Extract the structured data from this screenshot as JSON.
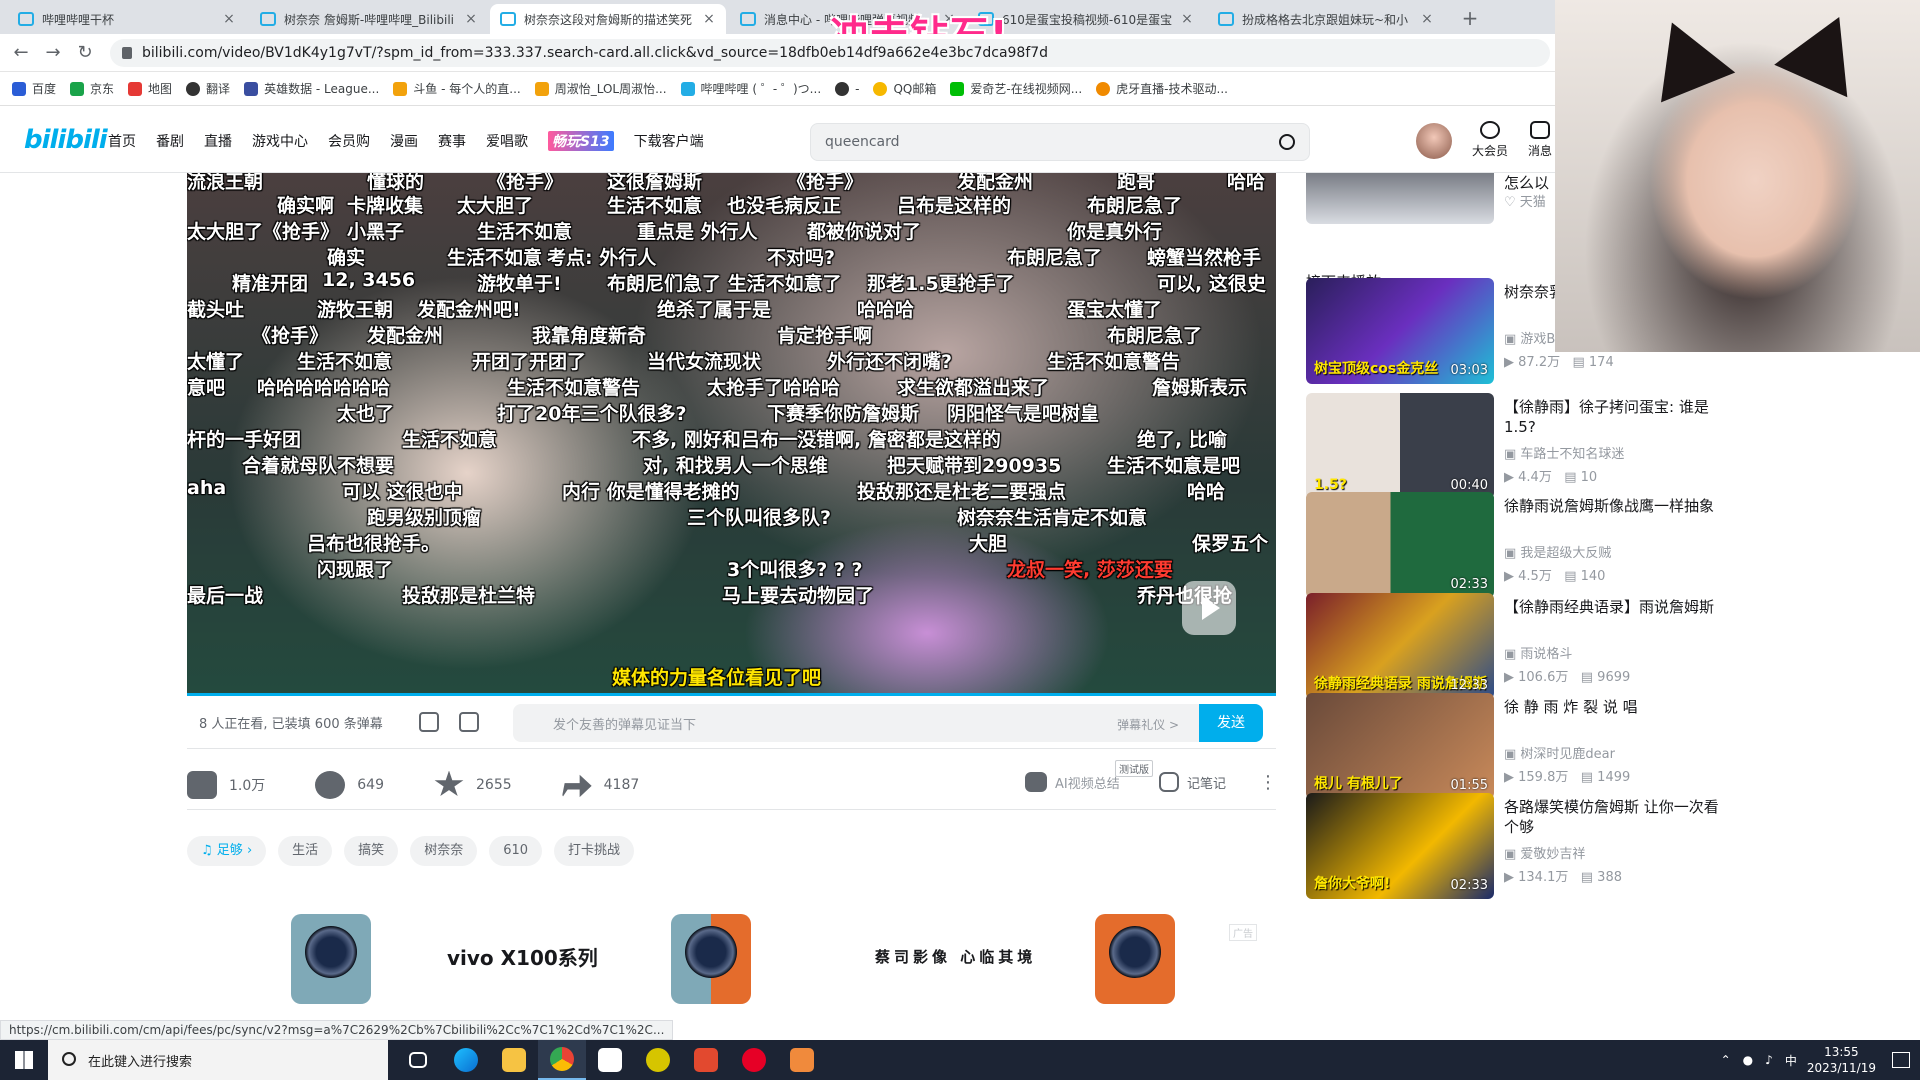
{
  "browser": {
    "tabs": [
      {
        "title": "哔哩哔哩干杯"
      },
      {
        "title": "树奈奈 詹姆斯-哔哩哔哩_Bilibili"
      },
      {
        "title": "树奈奈这段对詹姆斯的描述笑死"
      },
      {
        "title": "消息中心 - 哔哩哔哩弹幕视频"
      },
      {
        "title": "610是蛋宝投稿视频-610是蛋宝"
      },
      {
        "title": "扮成格格去北京跟姐妹玩~和小"
      }
    ],
    "url": "bilibili.com/video/BV1dK4y1g7vT/?spm_id_from=333.337.search-card.all.click&vd_source=18dfb0eb14df9a662e4e3bc7dca98f7d",
    "overlay_text": "冲击钻石!",
    "bookmarks": [
      "百度",
      "京东",
      "地图",
      "翻译",
      "英雄数据 - League...",
      "斗鱼 - 每个人的直...",
      "周淑怡_LOL周淑怡...",
      "哔哩哔哩 ( ゜- ゜)つ...",
      "-",
      "QQ邮箱",
      "爱奇艺-在线视频网...",
      "虎牙直播-技术驱动..."
    ],
    "status_url": "https://cm.bilibili.com/cm/api/fees/pc/sync/v2?msg=a%7C2629%2Cb%7Cbilibili%2Cc%7C1%2Cd%7C1%2C..."
  },
  "bili_header": {
    "logo": "bilibili",
    "nav": [
      "首页",
      "番剧",
      "直播",
      "游戏中心",
      "会员购",
      "漫画",
      "赛事",
      "爱唱歌",
      "畅玩S13",
      "下载客户端"
    ],
    "search_value": "queencard",
    "btn_vip": "大会员",
    "btn_msg": "消息"
  },
  "danmaku": [
    {
      "t": "流浪王朝"
    },
    {
      "t": "懂球的"
    },
    {
      "t": "《抢手》"
    },
    {
      "t": "这很詹姆斯"
    },
    {
      "t": "《抢手》"
    },
    {
      "t": "发配金州"
    },
    {
      "t": "跑哥"
    },
    {
      "t": "哈哈"
    },
    {
      "t": "确实啊"
    },
    {
      "t": "卡牌收集"
    },
    {
      "t": "太大胆了"
    },
    {
      "t": "生活不如意"
    },
    {
      "t": "也没毛病反正"
    },
    {
      "t": "吕布是这样的"
    },
    {
      "t": "布朗尼急了"
    },
    {
      "t": "太大胆了《抢手》"
    },
    {
      "t": "小黑子"
    },
    {
      "t": "生活不如意"
    },
    {
      "t": "重点是 外行人"
    },
    {
      "t": "都被你说对了"
    },
    {
      "t": "你是真外行"
    },
    {
      "t": "确实"
    },
    {
      "t": "生活不如意"
    },
    {
      "t": "考点: 外行人"
    },
    {
      "t": "不对吗?"
    },
    {
      "t": "布朗尼急了"
    },
    {
      "t": "螃蟹当然枪手"
    },
    {
      "t": "精准开团"
    },
    {
      "t": "12, 3456"
    },
    {
      "t": "游牧单于!"
    },
    {
      "t": "布朗尼们急了 生活不如意了"
    },
    {
      "t": "那老1.5更抢手了"
    },
    {
      "t": "可以, 这很史"
    },
    {
      "t": "截头吐"
    },
    {
      "t": "游牧王朝"
    },
    {
      "t": "发配金州吧!"
    },
    {
      "t": "绝杀了属于是"
    },
    {
      "t": "哈哈哈"
    },
    {
      "t": "蛋宝太懂了"
    },
    {
      "t": "《抢手》"
    },
    {
      "t": "发配金州"
    },
    {
      "t": "我靠角度新奇"
    },
    {
      "t": "肯定抢手啊"
    },
    {
      "t": "布朗尼急了"
    },
    {
      "t": "太懂了"
    },
    {
      "t": "生活不如意"
    },
    {
      "t": "开团了开团了"
    },
    {
      "t": "当代女流现状"
    },
    {
      "t": "外行还不闭嘴?"
    },
    {
      "t": "生活不如意警告"
    },
    {
      "t": "意吧"
    },
    {
      "t": "哈哈哈哈哈哈哈"
    },
    {
      "t": "生活不如意警告"
    },
    {
      "t": "太抢手了哈哈哈"
    },
    {
      "t": "求生欲都溢出来了"
    },
    {
      "t": "詹姆斯表示"
    },
    {
      "t": "太也了"
    },
    {
      "t": "打了20年三个队很多?"
    },
    {
      "t": "下赛季你防詹姆斯"
    },
    {
      "t": "阴阳怪气是吧树皇"
    },
    {
      "t": "杆的一手好团"
    },
    {
      "t": "生活不如意"
    },
    {
      "t": "不多, 刚好和吕布一样"
    },
    {
      "t": "没错啊, 詹密都是这样的"
    },
    {
      "t": "绝了, 比喻"
    },
    {
      "t": "合着就母队不想要"
    },
    {
      "t": "对, 和找男人一个思维"
    },
    {
      "t": "把天赋带到290935"
    },
    {
      "t": "生活不如意是吧"
    },
    {
      "t": "aha"
    },
    {
      "t": "可以 这很也中"
    },
    {
      "t": "内行  你是懂得老摊的"
    },
    {
      "t": "投敌那还是杜老二要强点"
    },
    {
      "t": "哈哈"
    },
    {
      "t": "跑男级别顶瘤"
    },
    {
      "t": "三个队叫很多队?"
    },
    {
      "t": "树奈奈生活肯定不如意"
    },
    {
      "t": "吕布也很抢手。"
    },
    {
      "t": "大胆"
    },
    {
      "t": "保罗五个"
    },
    {
      "t": "闪现跟了"
    },
    {
      "t": "3个叫很多? ? ?"
    },
    {
      "t": "龙叔一笑, 莎莎还要"
    },
    {
      "t": "最后一战"
    },
    {
      "t": "投敌那是杜兰特"
    },
    {
      "t": "马上要去动物园了"
    },
    {
      "t": "乔丹也很抢"
    },
    {
      "t": "媒体的力量各位看见了吧"
    }
  ],
  "sendbar": {
    "viewers": "8 人正在看, 已装填 600 条弹幕",
    "placeholder": "发个友善的弹幕见证当下",
    "etiquette": "弹幕礼仪 >",
    "send": "发送"
  },
  "actions": {
    "like": "1.0万",
    "coin": "649",
    "fav": "2655",
    "share": "4187",
    "ai_summary": "AI视频总结",
    "trial": "测试版",
    "notes": "记笔记"
  },
  "tags": [
    "足够",
    "生活",
    "搞笑",
    "树奈奈",
    "610",
    "打卡挑战"
  ],
  "ad": {
    "brand": "vivo X100系列",
    "slogan": "蔡司影像 心临其境",
    "ad_badge": "广告"
  },
  "sidebar": {
    "top_partial": {
      "title": "怎么以",
      "up": "天猫"
    },
    "next_label": "接下来播放",
    "cards": [
      {
        "title": "树奈奈乳太出",
        "up": "游戏BBQ",
        "views": "87.2万",
        "danmaku": "174",
        "duration": "03:03",
        "cap": "树宝顶级cos金克丝"
      },
      {
        "title": "【徐静雨】徐子拷问蛋宝: 谁是1.5?",
        "up": "车路士不知名球迷",
        "views": "4.4万",
        "danmaku": "10",
        "duration": "00:40",
        "cap": "1.5?"
      },
      {
        "title": "徐静雨说詹姆斯像战鹰一样抽象",
        "up": "我是超级大反贼",
        "views": "4.5万",
        "danmaku": "140",
        "duration": "02:33",
        "cap": ""
      },
      {
        "title": "【徐静雨经典语录】雨说詹姆斯",
        "up": "雨说格斗",
        "views": "106.6万",
        "danmaku": "9699",
        "duration": "12:33",
        "cap": "徐静雨经典语录 雨说詹姆斯"
      },
      {
        "title": "徐 静 雨 炸 裂 说 唱",
        "up": "树深时见鹿dear",
        "views": "159.8万",
        "danmaku": "1499",
        "duration": "01:55",
        "cap": "根儿  有根儿了"
      },
      {
        "title": "各路爆笑模仿詹姆斯 让你一次看个够",
        "up": "爱敬妙吉祥",
        "views": "134.1万",
        "danmaku": "388",
        "duration": "02:33",
        "cap": "詹你大爷啊!"
      }
    ]
  },
  "taskbar": {
    "search_placeholder": "在此键入进行搜索",
    "time": "13:55",
    "date": "2023/11/19",
    "ime": "中"
  }
}
